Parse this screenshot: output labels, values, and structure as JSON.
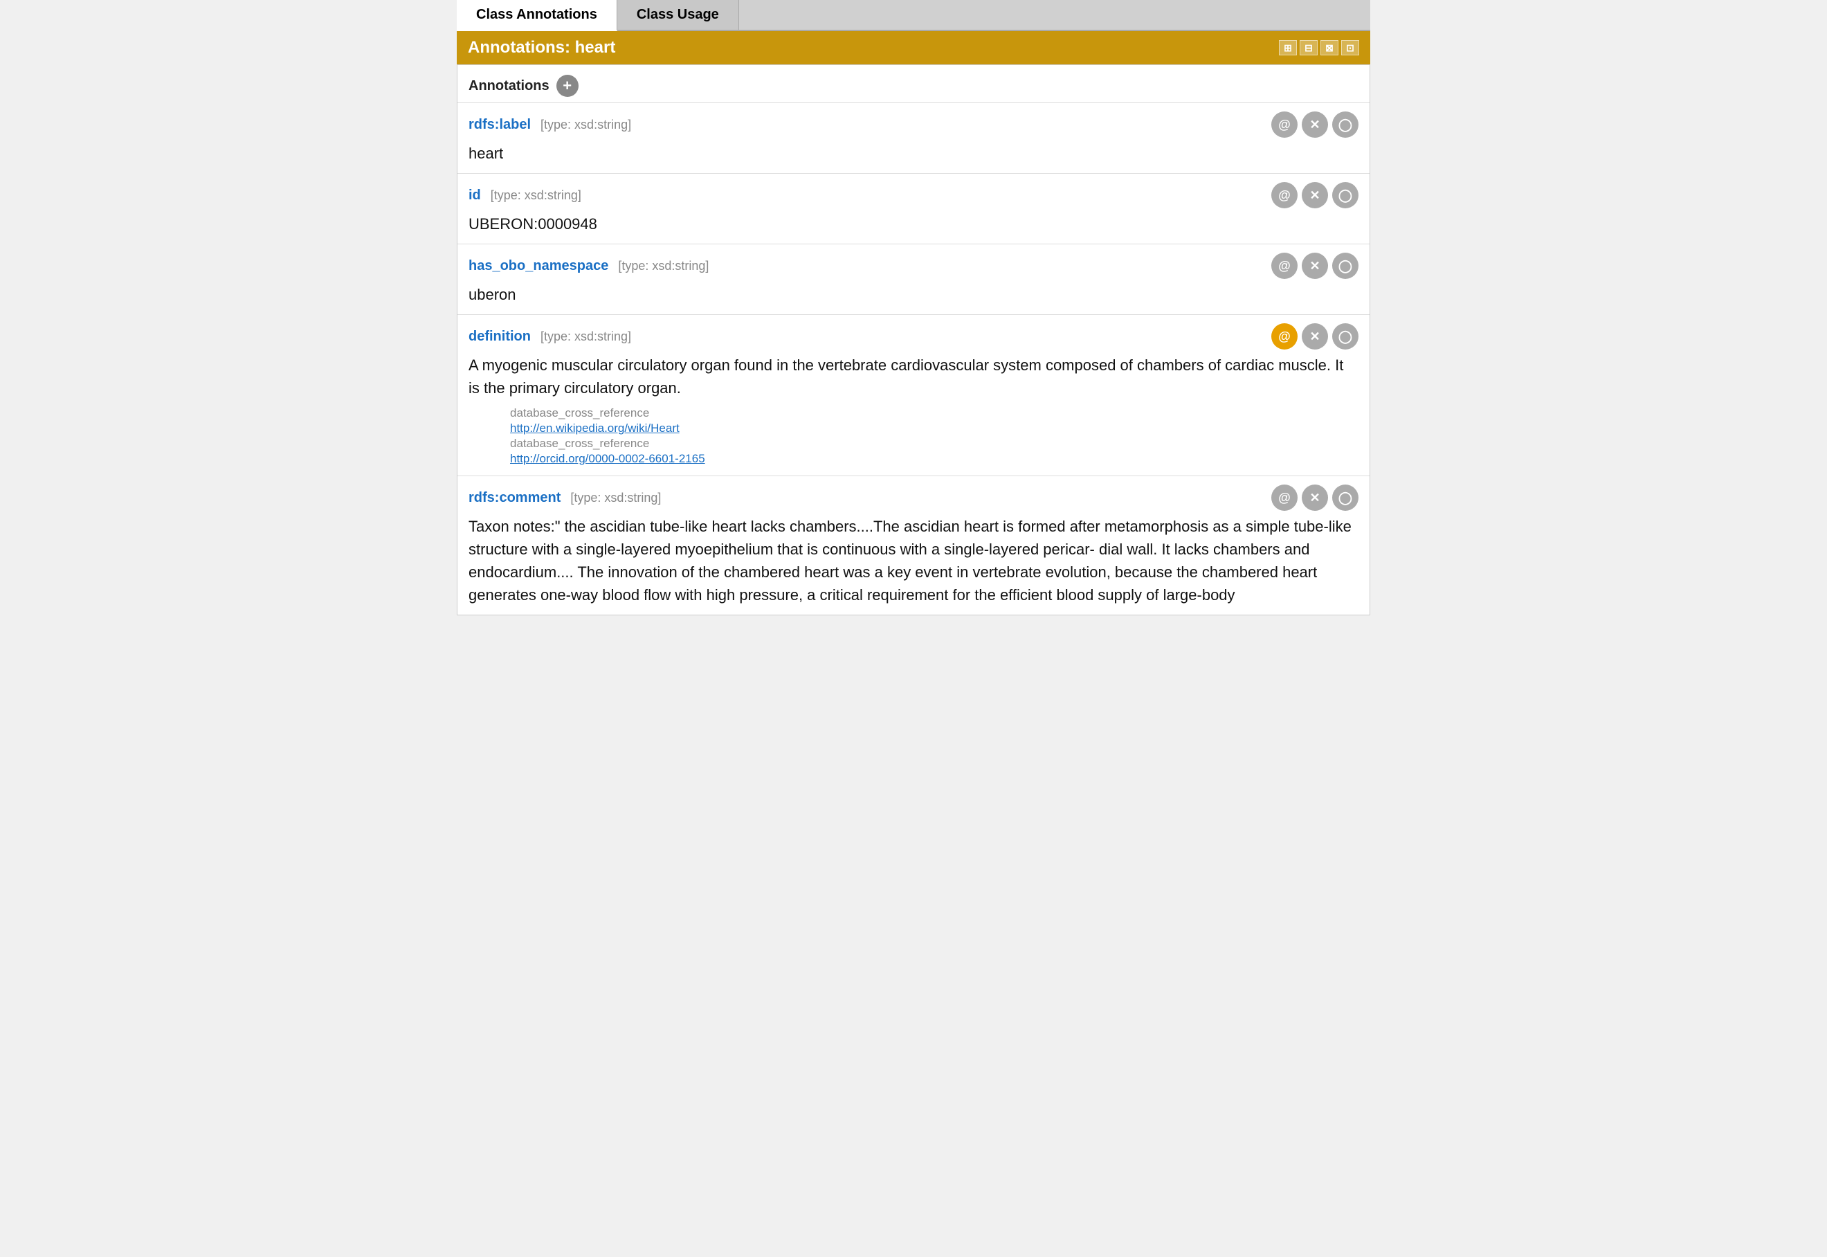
{
  "tabs": [
    {
      "id": "class-annotations",
      "label": "Class Annotations",
      "active": true
    },
    {
      "id": "class-usage",
      "label": "Class Usage",
      "active": false
    }
  ],
  "title_bar": {
    "label": "Annotations: heart",
    "icons": [
      "⊞",
      "⊟",
      "⊠",
      "⊡"
    ]
  },
  "section_header": {
    "label": "Annotations",
    "add_tooltip": "Add annotation"
  },
  "annotations": [
    {
      "id": "rdfs-label",
      "prop_name": "rdfs:label",
      "prop_type": "[type: xsd:string]",
      "value": "heart",
      "at_btn_yellow": false,
      "sub_annotations": []
    },
    {
      "id": "id",
      "prop_name": "id",
      "prop_type": "[type: xsd:string]",
      "value": "UBERON:0000948",
      "at_btn_yellow": false,
      "sub_annotations": []
    },
    {
      "id": "has-obo-namespace",
      "prop_name": "has_obo_namespace",
      "prop_type": "[type: xsd:string]",
      "value": "uberon",
      "at_btn_yellow": false,
      "sub_annotations": []
    },
    {
      "id": "definition",
      "prop_name": "definition",
      "prop_type": "[type: xsd:string]",
      "value": "A myogenic muscular circulatory organ found in the vertebrate cardiovascular system composed of chambers of cardiac muscle. It is the primary circulatory organ.",
      "at_btn_yellow": true,
      "sub_annotations": [
        {
          "label": "database_cross_reference",
          "link": null
        },
        {
          "label": "http://en.wikipedia.org/wiki/Heart",
          "link": "http://en.wikipedia.org/wiki/Heart"
        },
        {
          "label": "database_cross_reference",
          "link": null
        },
        {
          "label": "http://orcid.org/0000-0002-6601-2165",
          "link": "http://orcid.org/0000-0002-6601-2165"
        }
      ]
    },
    {
      "id": "rdfs-comment",
      "prop_name": "rdfs:comment",
      "prop_type": "[type: xsd:string]",
      "value": "Taxon notes:\" the ascidian tube-like heart lacks chambers....The ascidian heart is formed after metamorphosis as a simple tube-like structure with a single-layered myoepithelium that is continuous with a single-layered pericar- dial wall. It lacks chambers and endocardium.... The innovation of the chambered heart was a key event in vertebrate evolution, because the chambered heart generates one-way blood flow with high pressure, a critical requirement for the efficient blood supply of large-body",
      "at_btn_yellow": false,
      "sub_annotations": []
    }
  ],
  "buttons": {
    "at_label": "@",
    "x_label": "✕",
    "circle_label": "○"
  }
}
